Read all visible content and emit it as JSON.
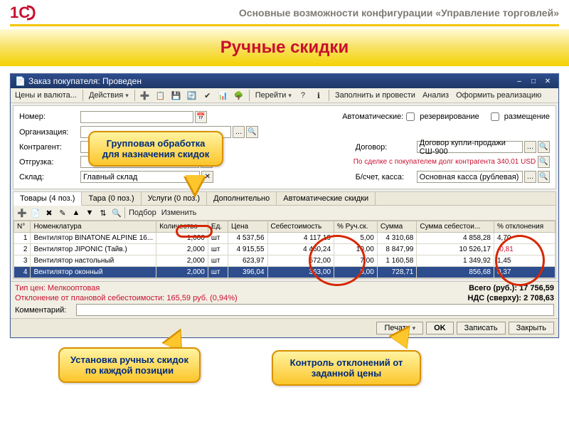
{
  "header": {
    "title": "Основные возможности конфигурации «Управление торговлей»"
  },
  "slide": {
    "title": "Ручные скидки"
  },
  "window": {
    "title": "Заказ покупателя: Проведен",
    "toolbar": {
      "prices": "Цены и валюта...",
      "actions": "Действия",
      "go": "Перейти",
      "fill": "Заполнить и провести",
      "analysis": "Анализ",
      "make_sale": "Оформить реализацию"
    },
    "form": {
      "number_lbl": "Номер:",
      "org_lbl": "Организация:",
      "contragent_lbl": "Контрагент:",
      "ship_lbl": "Отгрузка:",
      "warehouse_lbl": "Склад:",
      "warehouse_val": "Главный склад",
      "auto_lbl": "Автоматические:",
      "reserve_lbl": "резервирование",
      "place_lbl": "размещение",
      "contract_lbl": "Договор:",
      "contract_val": "Договор купли-продажи СШ-900",
      "account_lbl": "Б/счет, касса:",
      "account_val": "Основная касса (рублевая)",
      "debt": "По сделке с покупателем долг контрагента 340,01 USD"
    },
    "tabs": {
      "goods": "Товары (4 поз.)",
      "tare": "Тара (0 поз.)",
      "services": "Услуги (0 поз.)",
      "extra": "Дополнительно",
      "auto": "Автоматические скидки"
    },
    "grid": {
      "select": "Подбор",
      "change": "Изменить",
      "cols": {
        "n": "N°",
        "nom": "Номенклатура",
        "qty": "Количество",
        "unit": "Ед.",
        "price": "Цена",
        "cost": "Себестоимость",
        "disc": "% Руч.ск.",
        "sum": "Сумма",
        "sumcost": "Сумма себестои...",
        "dev": "% отклонения"
      },
      "rows": [
        {
          "n": "1",
          "nom": "Вентилятор BINATONE ALPINE 16...",
          "qty": "1,000",
          "unit": "шт",
          "price": "4 537,56",
          "cost": "4 117,19",
          "disc": "5,00",
          "sum": "4 310,68",
          "sumcost": "4 858,28",
          "dev": "4,70"
        },
        {
          "n": "2",
          "nom": "Вентилятор JIPONIC (Тайв.)",
          "qty": "2,000",
          "unit": "шт",
          "price": "4 915,55",
          "cost": "4 460,24",
          "disc": "10,00",
          "sum": "8 847,99",
          "sumcost": "10 526,17",
          "dev": "-0,81"
        },
        {
          "n": "3",
          "nom": "Вентилятор настольный",
          "qty": "2,000",
          "unit": "шт",
          "price": "623,97",
          "cost": "572,00",
          "disc": "7,00",
          "sum": "1 160,58",
          "sumcost": "1 349,92",
          "dev": "1,45"
        },
        {
          "n": "4",
          "nom": "Вентилятор оконный",
          "qty": "2,000",
          "unit": "шт",
          "price": "396,04",
          "cost": "363,00",
          "disc": "8,00",
          "sum": "728,71",
          "sumcost": "856,68",
          "dev": "0,37"
        }
      ]
    },
    "footer": {
      "price_type_lbl": "Тип цен: Мелкооптовая",
      "total_lbl": "Всего (руб.):",
      "total_val": "17 756,59",
      "dev_lbl": "Отклонение от плановой себестоимости: 165,59 руб. (0,94%)",
      "vat_lbl": "НДС (сверху):",
      "vat_val": "2 708,63",
      "comment_lbl": "Комментарий:"
    },
    "buttons": {
      "ok": "OK",
      "save": "Записать",
      "close": "Закрыть",
      "print": "Печать"
    }
  },
  "callouts": {
    "c1": "Групповая обработка для назначения скидок",
    "c2": "Установка ручных скидок по каждой позиции",
    "c3": "Контроль отклонений от заданной цены"
  }
}
